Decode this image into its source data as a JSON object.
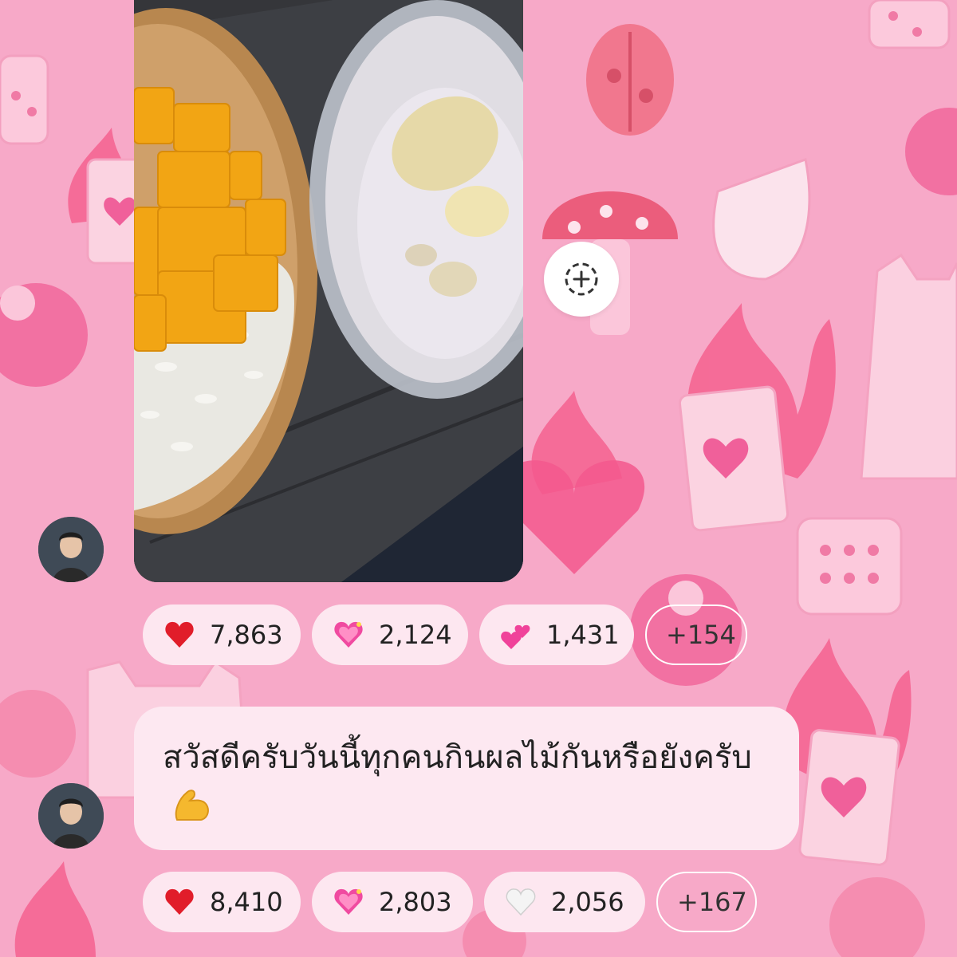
{
  "message_1": {
    "type": "photo",
    "sender_avatar": "avatar-boy",
    "reactions": [
      {
        "emoji": "red-heart",
        "count": "7,863"
      },
      {
        "emoji": "sparkling-heart",
        "count": "2,124"
      },
      {
        "emoji": "two-hearts",
        "count": "1,431"
      }
    ],
    "more_reactions": "+154"
  },
  "share_button": {
    "icon": "add-circle-dashed-icon"
  },
  "message_2": {
    "type": "text",
    "sender_avatar": "avatar-boy",
    "text": "สวัสดีครับวันนี้ทุกคนกินผลไม้กันหรือยังครับ",
    "emoji": "flexed-biceps",
    "reactions": [
      {
        "emoji": "red-heart",
        "count": "8,410"
      },
      {
        "emoji": "sparkling-heart",
        "count": "2,803"
      },
      {
        "emoji": "white-heart",
        "count": "2,056"
      }
    ],
    "more_reactions": "+167"
  },
  "colors": {
    "background": "#f7a9c8",
    "bubble": "#fde8f1",
    "pill": "#fde7f0"
  }
}
